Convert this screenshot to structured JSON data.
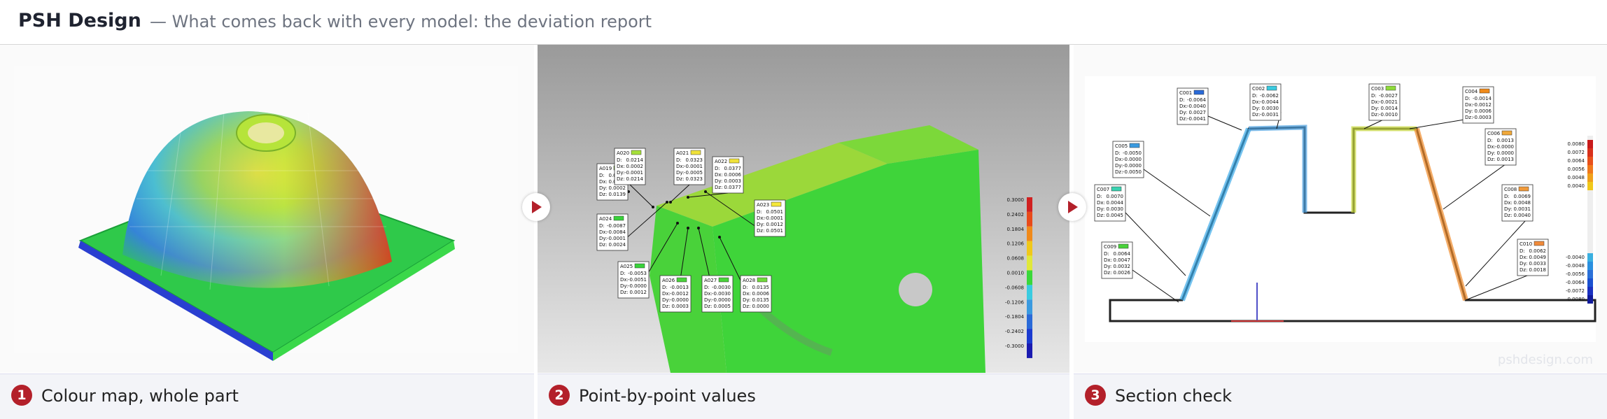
{
  "header": {
    "brand": "PSH Design",
    "tagline": "— What comes back with every model: the deviation report"
  },
  "panels": [
    {
      "number": "1",
      "caption": "Colour map, whole part"
    },
    {
      "number": "2",
      "caption": "Point-by-point values"
    },
    {
      "number": "3",
      "caption": "Section check"
    }
  ],
  "watermark": "pshdesign.com",
  "colors": {
    "accent": "#b3202a",
    "good": "#2ecc3a",
    "high": "#e8262a",
    "low": "#1a3fd6"
  },
  "scale_ticks": [
    "0.3000",
    "0.2402",
    "0.1804",
    "0.1206",
    "0.0608",
    "0.0010",
    "-0.0608",
    "-0.1206",
    "-0.1804",
    "-0.2402",
    "-0.3000"
  ],
  "annotations": [
    {
      "id": "A019",
      "rows": [
        [
          "D:",
          "0.0140"
        ],
        [
          "Dx:",
          "0.0004"
        ],
        [
          "Dy:",
          "0.0002"
        ],
        [
          "Dz:",
          "0.0139"
        ]
      ]
    },
    {
      "id": "A020",
      "rows": [
        [
          "D:",
          "0.0214"
        ],
        [
          "Dx:",
          "0.0002"
        ],
        [
          "Dy:",
          "-0.0001"
        ],
        [
          "Dz:",
          "0.0214"
        ]
      ]
    },
    {
      "id": "A021",
      "rows": [
        [
          "D:",
          "0.0323"
        ],
        [
          "Dx:",
          "-0.0001"
        ],
        [
          "Dy:",
          "-0.0005"
        ],
        [
          "Dz:",
          "0.0323"
        ]
      ]
    },
    {
      "id": "A022",
      "rows": [
        [
          "D:",
          "0.0377"
        ],
        [
          "Dx:",
          "0.0006"
        ],
        [
          "Dy:",
          "0.0003"
        ],
        [
          "Dz:",
          "0.0377"
        ]
      ]
    },
    {
      "id": "A023",
      "rows": [
        [
          "D:",
          "0.0501"
        ],
        [
          "Dx:",
          "-0.0001"
        ],
        [
          "Dy:",
          "0.0012"
        ],
        [
          "Dz:",
          "0.0501"
        ]
      ]
    },
    {
      "id": "A024",
      "rows": [
        [
          "D:",
          "-0.0087"
        ],
        [
          "Dx:",
          "-0.0084"
        ],
        [
          "Dy:",
          "-0.0001"
        ],
        [
          "Dz:",
          "0.0024"
        ]
      ]
    },
    {
      "id": "A025",
      "rows": [
        [
          "D:",
          "-0.0053"
        ],
        [
          "Dx:",
          "-0.0051"
        ],
        [
          "Dy:",
          "-0.0000"
        ],
        [
          "Dz:",
          "0.0012"
        ]
      ]
    },
    {
      "id": "A026",
      "rows": [
        [
          "D:",
          "-0.0013"
        ],
        [
          "Dx:",
          "-0.0012"
        ],
        [
          "Dy:",
          "-0.0000"
        ],
        [
          "Dz:",
          "0.0003"
        ]
      ]
    },
    {
      "id": "A027",
      "rows": [
        [
          "D:",
          "-0.0030"
        ],
        [
          "Dx:",
          "-0.0030"
        ],
        [
          "Dy:",
          "-0.0000"
        ],
        [
          "Dz:",
          "0.0005"
        ]
      ]
    },
    {
      "id": "A028",
      "rows": [
        [
          "D:",
          "0.0135"
        ],
        [
          "Dx:",
          "0.0006"
        ],
        [
          "Dy:",
          "0.0135"
        ],
        [
          "Dz:",
          "0.0000"
        ]
      ]
    }
  ],
  "sections": [
    {
      "id": "C001",
      "rows": [
        [
          "D:",
          "-0.0064"
        ],
        [
          "Dx:",
          "-0.0040"
        ],
        [
          "Dy:",
          "0.0027"
        ],
        [
          "Dz:",
          "-0.0041"
        ]
      ]
    },
    {
      "id": "C002",
      "rows": [
        [
          "D:",
          "-0.0062"
        ],
        [
          "Dx:",
          "-0.0044"
        ],
        [
          "Dy:",
          "0.0030"
        ],
        [
          "Dz:",
          "-0.0031"
        ]
      ]
    },
    {
      "id": "C003",
      "rows": [
        [
          "D:",
          "-0.0027"
        ],
        [
          "Dx:",
          "-0.0021"
        ],
        [
          "Dy:",
          "0.0014"
        ],
        [
          "Dz:",
          "-0.0010"
        ]
      ]
    },
    {
      "id": "C004",
      "rows": [
        [
          "D:",
          "-0.0014"
        ],
        [
          "Dx:",
          "-0.0012"
        ],
        [
          "Dy:",
          "0.0006"
        ],
        [
          "Dz:",
          "-0.0003"
        ]
      ]
    },
    {
      "id": "C005",
      "rows": [
        [
          "D:",
          "-0.0050"
        ],
        [
          "Dx:",
          "-0.0000"
        ],
        [
          "Dy:",
          "-0.0000"
        ],
        [
          "Dz:",
          "-0.0050"
        ]
      ]
    },
    {
      "id": "C006",
      "rows": [
        [
          "D:",
          "0.0013"
        ],
        [
          "Dx:",
          "-0.0000"
        ],
        [
          "Dy:",
          "0.0000"
        ],
        [
          "Dz:",
          "0.0013"
        ]
      ]
    },
    {
      "id": "C007",
      "rows": [
        [
          "D:",
          "0.0070"
        ],
        [
          "Dx:",
          "0.0044"
        ],
        [
          "Dy:",
          "0.0030"
        ],
        [
          "Dz:",
          "0.0045"
        ]
      ]
    },
    {
      "id": "C008",
      "rows": [
        [
          "D:",
          "0.0069"
        ],
        [
          "Dx:",
          "0.0048"
        ],
        [
          "Dy:",
          "0.0031"
        ],
        [
          "Dz:",
          "0.0040"
        ]
      ]
    },
    {
      "id": "C009",
      "rows": [
        [
          "D:",
          "0.0064"
        ],
        [
          "Dx:",
          "0.0047"
        ],
        [
          "Dy:",
          "0.0032"
        ],
        [
          "Dz:",
          "0.0026"
        ]
      ]
    },
    {
      "id": "C010",
      "rows": [
        [
          "D:",
          "0.0062"
        ],
        [
          "Dx:",
          "0.0049"
        ],
        [
          "Dy:",
          "0.0033"
        ],
        [
          "Dz:",
          "0.0018"
        ]
      ]
    }
  ],
  "section_scale": [
    "0.0080",
    "0.0072",
    "0.0064",
    "0.0056",
    "0.0048",
    "0.0040",
    "-0.0040",
    "-0.0048",
    "-0.0056",
    "-0.0064",
    "-0.0072",
    "-0.0080"
  ]
}
